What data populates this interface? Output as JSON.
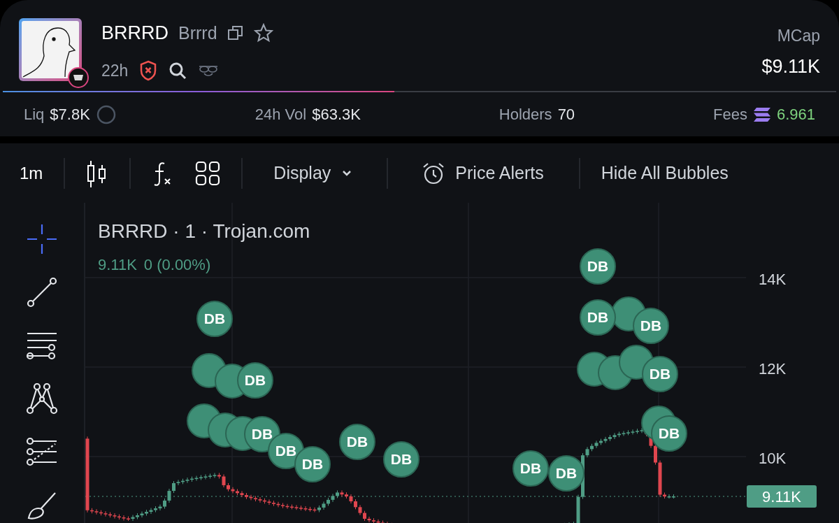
{
  "token": {
    "symbol": "BRRRD",
    "name": "Brrrd",
    "age": "22h",
    "mcap_label": "MCap",
    "mcap": "$9.11K"
  },
  "progress": {
    "level": 0.47
  },
  "stats": [
    {
      "kind": "liq",
      "label": "Liq",
      "value": "$7.8K"
    },
    {
      "kind": "plain",
      "label": "24h Vol",
      "value": "$63.3K"
    },
    {
      "kind": "plain",
      "label": "Holders",
      "value": "70"
    },
    {
      "kind": "fees",
      "label": "Fees",
      "value": "6.961"
    }
  ],
  "toolbar": {
    "interval": "1m",
    "display": "Display",
    "price_alerts": "Price Alerts",
    "hide_bubbles": "Hide All Bubbles"
  },
  "tools": [
    {
      "kind": "crosshair",
      "selected": true
    },
    {
      "kind": "trendline",
      "selected": false
    },
    {
      "kind": "hlines",
      "selected": false
    },
    {
      "kind": "pattern",
      "selected": false
    },
    {
      "kind": "fib",
      "selected": false
    },
    {
      "kind": "brush",
      "selected": false
    }
  ],
  "chart": {
    "legend": "BRRRD · 1 · Trojan.com",
    "price": "9.11K",
    "change": "0 (0.00%)",
    "y_labels": [
      "14K",
      "12K",
      "10K"
    ],
    "last_price": "9.11K",
    "bubbles": [
      {
        "label": "DB"
      },
      {
        "label": "DB"
      },
      {
        "label": "DB"
      },
      {
        "label": "DB"
      },
      {
        "label": "DB"
      },
      {
        "label": "DB"
      },
      {
        "label": "DB"
      },
      {
        "label": "DB"
      },
      {
        "label": "DB"
      },
      {
        "label": "DB"
      },
      {
        "label": "DB"
      },
      {
        "label": "DB"
      },
      {
        "label": "DB"
      },
      {
        "label": "DB"
      }
    ]
  }
}
